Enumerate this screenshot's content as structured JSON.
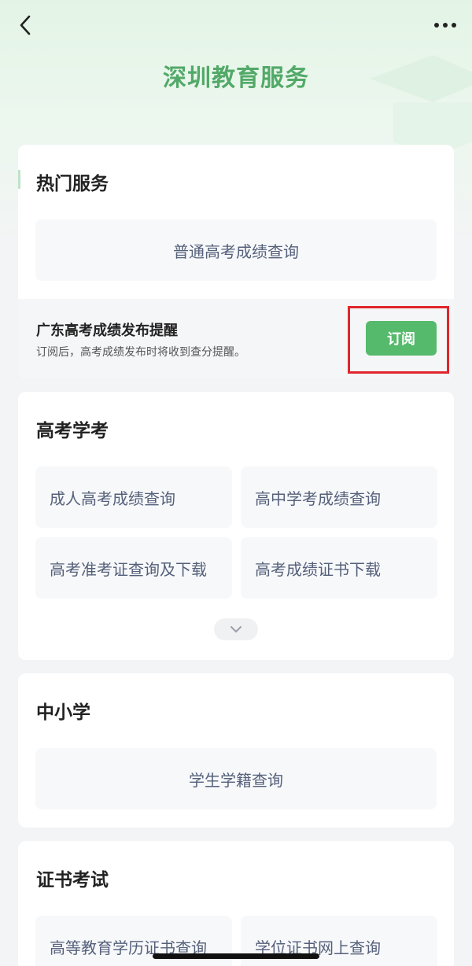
{
  "header": {
    "title": "深圳教育服务",
    "back_icon": "chevron-left-icon",
    "more_icon": "more-horizontal-icon"
  },
  "hot_services": {
    "title": "热门服务",
    "tile": "普通高考成绩查询",
    "notify": {
      "title": "广东高考成绩发布提醒",
      "desc": "订阅后，高考成绩发布时将收到查分提醒。",
      "button": "订阅"
    }
  },
  "gaokao": {
    "title": "高考学考",
    "tiles": [
      "成人高考成绩查询",
      "高中学考成绩查询",
      "高考准考证查询及下载",
      "高考成绩证书下载"
    ],
    "expand_icon": "chevron-down-icon"
  },
  "primary_secondary": {
    "title": "中小学",
    "tile": "学生学籍查询"
  },
  "certificate": {
    "title": "证书考试",
    "tiles": [
      "高等教育学历证书查询",
      "学位证书网上查询"
    ]
  },
  "colors": {
    "brand_green": "#52a968",
    "button_green": "#56ba6c",
    "highlight_red": "#e0262c"
  }
}
